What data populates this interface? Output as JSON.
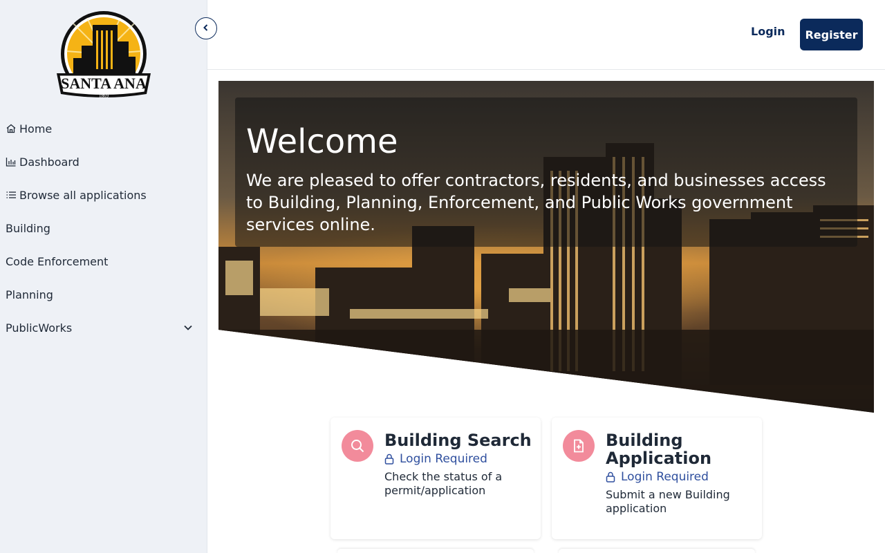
{
  "logo": {
    "text": "SANTA ANA",
    "year": "1869"
  },
  "sidebar": {
    "collapse_icon": "chevron-left-icon",
    "items": [
      {
        "label": "Home",
        "icon": "home-icon"
      },
      {
        "label": "Dashboard",
        "icon": "bar-chart-icon"
      },
      {
        "label": "Browse all applications",
        "icon": "list-icon"
      },
      {
        "label": "Building"
      },
      {
        "label": "Code Enforcement"
      },
      {
        "label": "Planning"
      },
      {
        "label": "PublicWorks",
        "icon": "chevron-down-icon"
      }
    ]
  },
  "header": {
    "login_label": "Login",
    "register_label": "Register"
  },
  "hero": {
    "title": "Welcome",
    "text": "We are pleased to offer contractors, residents, and businesses access to Building, Planning, Enforcement, and Public Works government services online."
  },
  "cards": [
    {
      "title": "Building Search",
      "lock_text": "Login Required",
      "description": "Check the status of a permit/application",
      "icon": "search-icon"
    },
    {
      "title": "Building Application",
      "lock_text": "Login Required",
      "description": "Submit a new Building application",
      "icon": "file-plus-icon"
    }
  ],
  "colors": {
    "primary": "#0b2a5b",
    "accent": "#f28b9b",
    "link": "#2f4f9e",
    "sidebar_bg": "#eef1f6"
  }
}
